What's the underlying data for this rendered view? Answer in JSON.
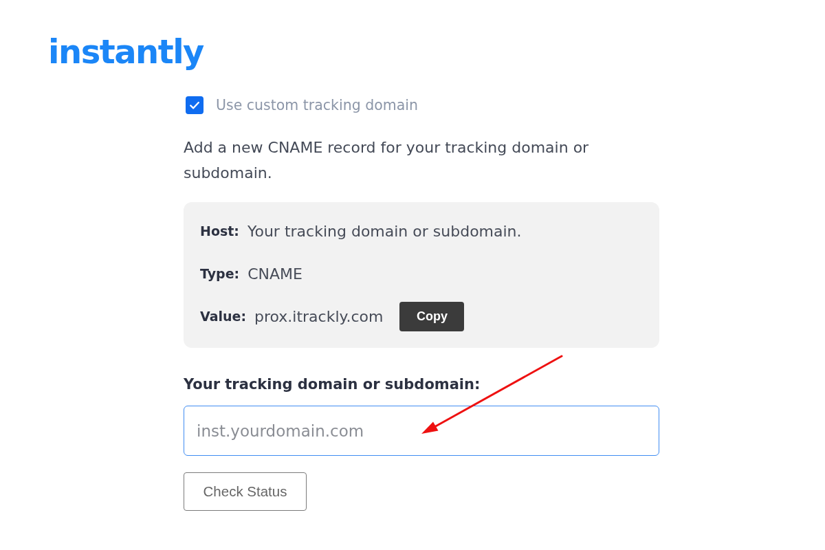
{
  "logo": {
    "text": "instantly"
  },
  "tracking_checkbox": {
    "label": "Use custom tracking domain",
    "checked": true
  },
  "instructions": "Add a new CNAME record for your tracking domain or subdomain.",
  "record": [
    {
      "label": "Host:",
      "value": "Your tracking domain or subdomain."
    },
    {
      "label": "Type:",
      "value": "CNAME"
    },
    {
      "label": "Value:",
      "value": "prox.itrackly.com",
      "copy_button": "Copy"
    }
  ],
  "domain_field": {
    "label": "Your tracking domain or subdomain:",
    "placeholder": "inst.yourdomain.com",
    "focused": true
  },
  "check_button": "Check Status"
}
